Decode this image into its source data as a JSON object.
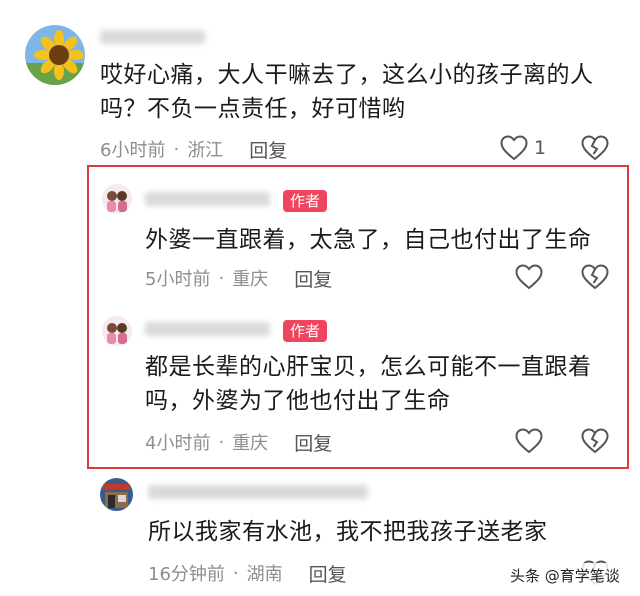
{
  "colors": {
    "author_tag": "#f0455e",
    "highlight_border": "#e23a3a",
    "meta_text": "#8e8e8e"
  },
  "comments": [
    {
      "text_lines": [
        "哎好心痛，大人干嘛去了，这么小的孩子离的人",
        "吗？不负一点责任，好可惜哟"
      ],
      "time": "6小时前",
      "location": "浙江",
      "reply_label": "回复",
      "like_count": "1",
      "avatar_icon": "sunflower-icon"
    },
    {
      "author_tag": "作者",
      "text_lines": [
        "外婆一直跟着，太急了，自己也付出了生命"
      ],
      "time": "5小时前",
      "location": "重庆",
      "reply_label": "回复",
      "avatar_icon": "family-photo-icon"
    },
    {
      "author_tag": "作者",
      "text_lines": [
        "都是长辈的心肝宝贝，怎么可能不一直跟着",
        "吗，外婆为了他也付出了生命"
      ],
      "time": "4小时前",
      "location": "重庆",
      "reply_label": "回复",
      "avatar_icon": "family-photo-icon"
    },
    {
      "text_lines": [
        "所以我家有水池，我不把我孩子送老家"
      ],
      "time": "16分钟前",
      "location": "湖南",
      "reply_label": "回复",
      "avatar_icon": "storefront-icon"
    }
  ],
  "meta_separator": "·",
  "watermark": "头条 @育学笔谈"
}
